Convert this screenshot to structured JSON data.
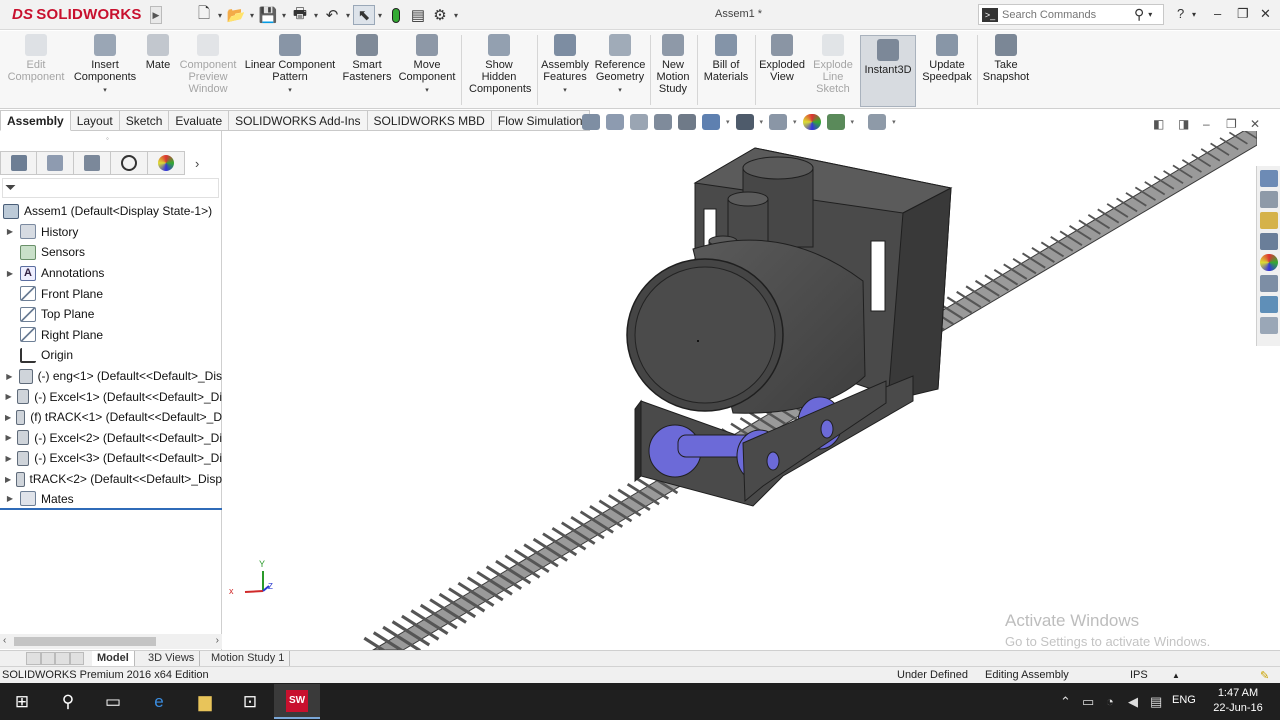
{
  "app": {
    "logo_brand": "SOLIDWORKS",
    "document_title": "Assem1 *",
    "search": {
      "placeholder": "Search Commands"
    }
  },
  "quick_access": {
    "icons": [
      "new-icon",
      "open-icon",
      "save-icon",
      "print-icon",
      "undo-icon",
      "select-icon",
      "rebuild-icon",
      "file-properties-icon",
      "options-icon"
    ]
  },
  "ribbon": {
    "edit_component": "Edit Component",
    "insert_components": "Insert Components",
    "mate": "Mate",
    "component_preview": "Component Preview Window",
    "linear_pattern": "Linear Component Pattern",
    "smart_fasteners": "Smart Fasteners",
    "move_component": "Move Component",
    "show_hidden": "Show Hidden Components",
    "assembly_features": "Assembly Features",
    "reference_geometry": "Reference Geometry",
    "new_motion_study": "New Motion Study",
    "bill_of_materials": "Bill of Materials",
    "exploded_view": "Exploded View",
    "explode_line_sketch": "Explode Line Sketch",
    "instant3d": "Instant3D",
    "update_speedpak": "Update Speedpak",
    "take_snapshot": "Take Snapshot"
  },
  "command_tabs": [
    "Assembly",
    "Layout",
    "Sketch",
    "Evaluate",
    "SOLIDWORKS Add-Ins",
    "SOLIDWORKS MBD",
    "Flow Simulation"
  ],
  "feature_tree": {
    "root": "Assem1  (Default<Display State-1>)",
    "items": [
      {
        "label": "History",
        "icon": "folder-icon",
        "expandable": true
      },
      {
        "label": "Sensors",
        "icon": "sensor-icon",
        "expandable": false
      },
      {
        "label": "Annotations",
        "icon": "annotation-icon",
        "expandable": true
      },
      {
        "label": "Front Plane",
        "icon": "plane-icon",
        "expandable": false
      },
      {
        "label": "Top Plane",
        "icon": "plane-icon",
        "expandable": false
      },
      {
        "label": "Right Plane",
        "icon": "plane-icon",
        "expandable": false
      },
      {
        "label": "Origin",
        "icon": "origin-icon",
        "expandable": false
      },
      {
        "label": "(-) eng<1> (Default<<Default>_Dis",
        "icon": "part-icon",
        "expandable": true
      },
      {
        "label": "(-) Excel<1> (Default<<Default>_Di",
        "icon": "part-icon",
        "expandable": true
      },
      {
        "label": "(f) tRACK<1> (Default<<Default>_D",
        "icon": "part-icon",
        "expandable": true
      },
      {
        "label": "(-) Excel<2> (Default<<Default>_Di",
        "icon": "part-icon",
        "expandable": true
      },
      {
        "label": "(-) Excel<3> (Default<<Default>_Di",
        "icon": "part-icon",
        "expandable": true
      },
      {
        "label": "tRACK<2> (Default<<Default>_Disp",
        "icon": "part-icon",
        "expandable": true
      },
      {
        "label": "Mates",
        "icon": "mates-icon",
        "expandable": true
      }
    ]
  },
  "bottom_tabs": [
    "Model",
    "3D Views",
    "Motion Study 1"
  ],
  "status": {
    "edition": "SOLIDWORKS Premium 2016 x64 Edition",
    "state": "Under Defined",
    "mode": "Editing Assembly",
    "units": "IPS"
  },
  "watermark": {
    "line1": "Activate Windows",
    "line2": "Go to Settings to activate Windows."
  },
  "viewport": {
    "triad": {
      "x": "x",
      "y": "Y",
      "z": "Z"
    }
  },
  "taskbar": {
    "language": "ENG",
    "time": "1:47 AM",
    "date": "22-Jun-16",
    "sw_badge": "SW"
  },
  "colors": {
    "brand_red": "#c8102e",
    "locomotive_body": "#4a4a4a",
    "wheels": "#6c6ad8",
    "track": "#8a8a8a"
  }
}
